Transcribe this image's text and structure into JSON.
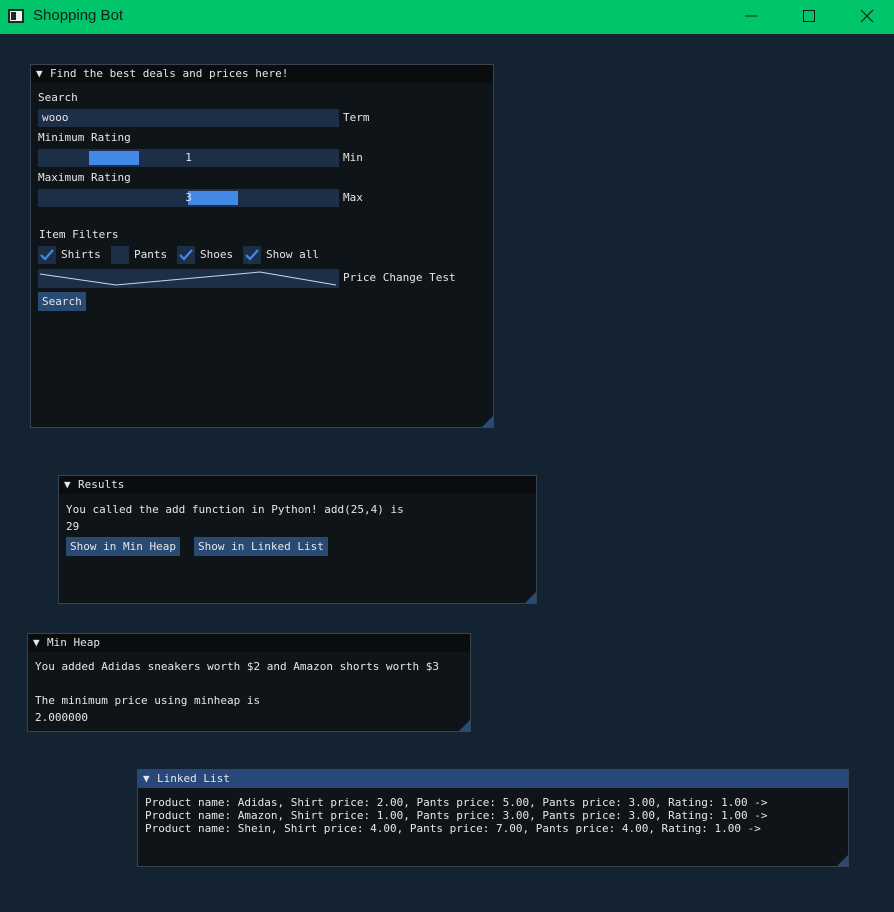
{
  "window": {
    "title": "Shopping Bot"
  },
  "finder": {
    "header": "Find the best deals and prices here!",
    "search_label": "Search",
    "search_value": "wooo",
    "term_label": "Term",
    "min_label": "Minimum Rating",
    "min_value": "1",
    "min_fraction": 0.25,
    "min_suffix": "Min",
    "max_label": "Maximum Rating",
    "max_value": "3",
    "max_fraction": 0.5,
    "max_suffix": "Max",
    "filters_label": "Item Filters",
    "filters": [
      {
        "label": "Shirts",
        "checked": true
      },
      {
        "label": "Pants",
        "checked": false
      },
      {
        "label": "Shoes",
        "checked": true
      },
      {
        "label": "Show all",
        "checked": true
      }
    ],
    "plot_label": "Price Change Test",
    "search_button": "Search"
  },
  "results": {
    "header": "Results",
    "line1": "You called the add function in Python! add(25,4) is",
    "line2": "29",
    "btn_heap": "Show in Min Heap",
    "btn_list": "Show in Linked List"
  },
  "minheap": {
    "header": "Min Heap",
    "line1": "You added Adidas sneakers worth $2 and Amazon shorts worth $3",
    "line2": "The minimum price using minheap is",
    "line3": "2.000000"
  },
  "linkedlist": {
    "header": "Linked List",
    "rows": [
      "Product name: Adidas, Shirt price: 2.00, Pants price: 5.00, Pants price: 3.00, Rating: 1.00 ->",
      "Product name: Amazon, Shirt price: 1.00, Pants price: 3.00, Pants price: 3.00, Rating: 1.00 ->",
      "Product name: Shein, Shirt price: 4.00, Pants price: 7.00, Pants price: 4.00, Rating: 1.00 ->"
    ]
  },
  "colors": {
    "titlebar": "#00c56a",
    "background": "#142331",
    "accent": "#4389e8",
    "frame": "#1d2e47",
    "button": "#294a72"
  },
  "icons": [
    "app-icon",
    "minimize-icon",
    "maximize-icon",
    "close-icon",
    "collapse-arrow-icon",
    "checkmark-icon",
    "resize-grip-icon"
  ]
}
